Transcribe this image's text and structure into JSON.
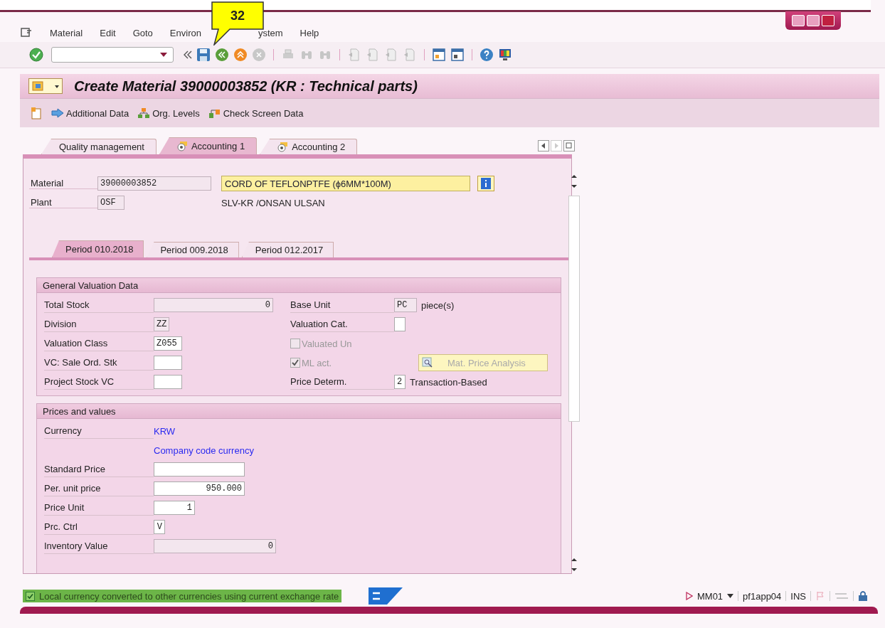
{
  "menu": [
    {
      "label": "Material"
    },
    {
      "label": "Edit"
    },
    {
      "label": "Goto"
    },
    {
      "label": "Environ"
    },
    {
      "label": "ystem"
    },
    {
      "label": "Help"
    }
  ],
  "callout": {
    "text": "32"
  },
  "title": "Create Material 39000003852 (KR : Technical parts)",
  "app_toolbar": [
    {
      "label": "Additional Data",
      "kind": "arrow"
    },
    {
      "label": "Org. Levels",
      "kind": "org"
    },
    {
      "label": "Check Screen Data",
      "kind": "check"
    }
  ],
  "tabs": [
    {
      "label": "Quality management",
      "selected": false
    },
    {
      "label": "Accounting 1",
      "selected": true
    },
    {
      "label": "Accounting 2",
      "selected": false
    }
  ],
  "header": {
    "material_label": "Material",
    "material": "39000003852",
    "description": "CORD OF TEFLONPTFE (ϕ6MM*100M)",
    "plant_label": "Plant",
    "plant": "OSF",
    "plant_name": "SLV-KR   /ONSAN ULSAN"
  },
  "period_tabs": [
    {
      "label": "Period 010.2018",
      "selected": true
    },
    {
      "label": "Period 009.2018",
      "selected": false
    },
    {
      "label": "Period 012.2017",
      "selected": false
    }
  ],
  "general": {
    "title": "General Valuation Data",
    "left": [
      {
        "kind": "field",
        "label": "Total Stock",
        "value": "0",
        "readonly": true
      },
      {
        "kind": "field",
        "label": "Division",
        "value": "ZZ",
        "readonly": true
      },
      {
        "kind": "field",
        "label": "Valuation Class",
        "value": "Z055",
        "readonly": false
      },
      {
        "kind": "field",
        "label": "VC: Sale Ord. Stk",
        "readonly": false
      },
      {
        "kind": "field",
        "label": "Project Stock VC",
        "readonly": false
      }
    ],
    "right": [
      {
        "kind": "field",
        "label": "Base Unit",
        "value": "PC",
        "readonly": true,
        "note": "piece(s)"
      },
      {
        "kind": "field",
        "label": "Valuation Cat.",
        "readonly": false
      },
      {
        "kind": "checkbox",
        "label": "Valuated Un",
        "checked": false
      },
      {
        "kind": "checkbox",
        "label": "ML act.",
        "checked": true,
        "button": "Mat. Price Analysis"
      },
      {
        "kind": "field",
        "label": "Price Determ.",
        "value": "2",
        "readonly": false,
        "note": "Transaction-Based"
      }
    ]
  },
  "prices": {
    "title": "Prices and values",
    "rows": [
      {
        "kind": "text",
        "label": "Currency",
        "value": "KRW"
      },
      {
        "kind": "text",
        "value": "Company code currency"
      },
      {
        "kind": "field",
        "label": "Standard Price",
        "readonly": false
      },
      {
        "kind": "field",
        "label": "Per. unit price",
        "value": "950.000",
        "readonly": false
      },
      {
        "kind": "field",
        "label": "Price Unit",
        "value": "1",
        "readonly": false
      },
      {
        "kind": "field",
        "label": "Prc. Ctrl",
        "value": "V",
        "readonly": false
      },
      {
        "kind": "field",
        "label": "Inventory Value",
        "value": "0",
        "readonly": true
      }
    ]
  },
  "status_bar": {
    "message": "Local currency converted to other currencies using current exchange rate",
    "kind": "success",
    "transaction": "MM01",
    "server": "pf1app04",
    "mode": "INS"
  }
}
